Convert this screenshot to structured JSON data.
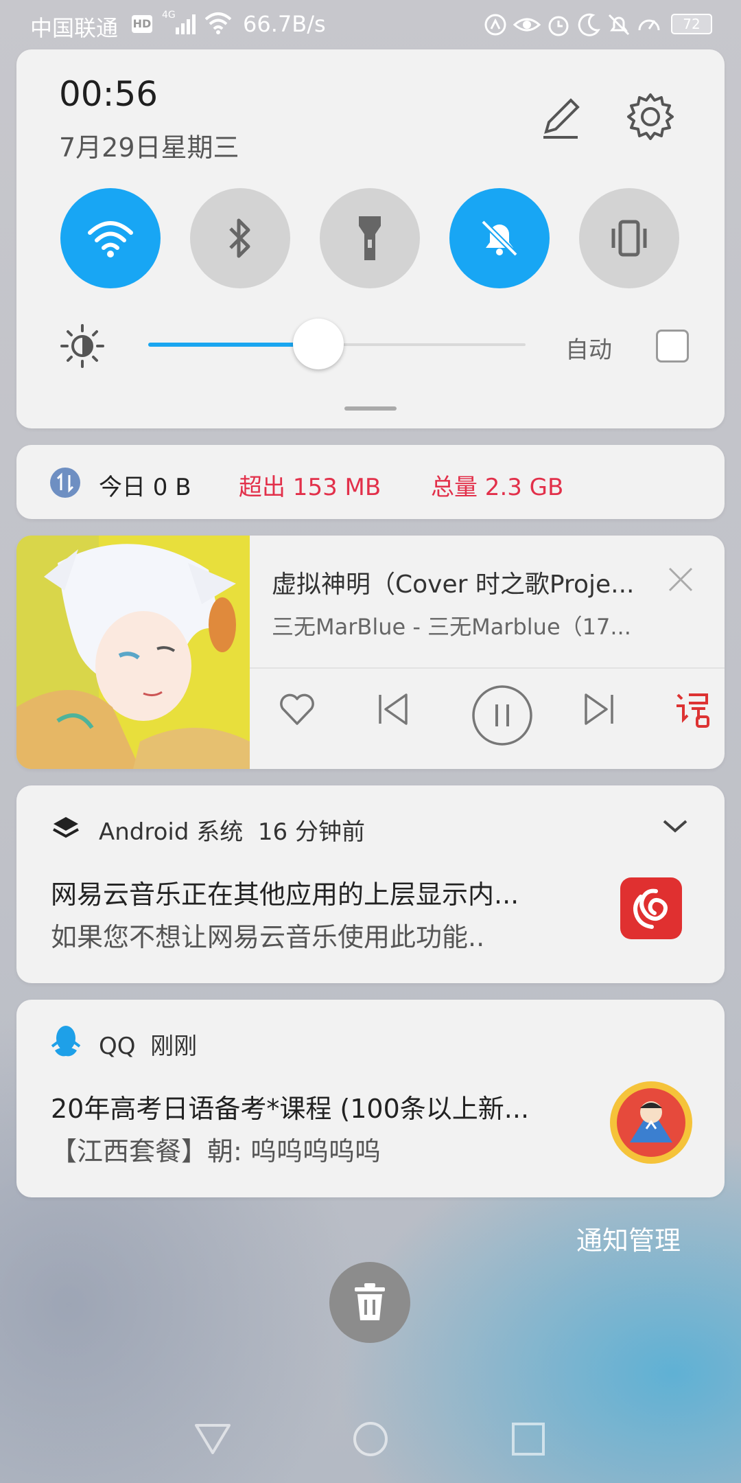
{
  "status_bar": {
    "carrier": "中国联通",
    "hd_badge": "HD",
    "network_type": "4G",
    "speed": "66.7B/s",
    "battery": "72",
    "icons": [
      "nfc-icon",
      "eye-icon",
      "alarm-icon",
      "moon-icon",
      "notification-off-icon",
      "speed-icon"
    ]
  },
  "quick_settings": {
    "time": "00:56",
    "date": "7月29日星期三",
    "tiles": [
      {
        "name": "wifi",
        "icon": "wifi-icon",
        "on": true
      },
      {
        "name": "bluetooth",
        "icon": "bluetooth-icon",
        "on": false
      },
      {
        "name": "flashlight",
        "icon": "flashlight-icon",
        "on": false
      },
      {
        "name": "silent",
        "icon": "bell-off-icon",
        "on": true
      },
      {
        "name": "vibrate",
        "icon": "vibrate-icon",
        "on": false
      }
    ],
    "brightness_level": 0.45,
    "auto_label": "自动",
    "auto_checked": false
  },
  "data_usage": {
    "today": "今日 0 B",
    "over": "超出 153 MB",
    "total": "总量 2.3 GB",
    "accent": "#e2304a"
  },
  "music": {
    "title": "虚拟神明（Cover 时之歌Proje...",
    "artist": "三无MarBlue - 三无Marblue（17..."
  },
  "notifications": [
    {
      "app": "Android 系统",
      "time": "16 分钟前",
      "title": "网易云音乐正在其他应用的上层显示内...",
      "text": "如果您不想让网易云音乐使用此功能.."
    },
    {
      "app": "QQ",
      "time": "刚刚",
      "title": "20年高考日语备考*课程 (100条以上新...",
      "text": "【江西套餐】朝: 呜呜呜呜呜"
    }
  ],
  "manage_label": "通知管理",
  "colors": {
    "accent_blue": "#18a6f4",
    "netease_red": "#e03030"
  }
}
